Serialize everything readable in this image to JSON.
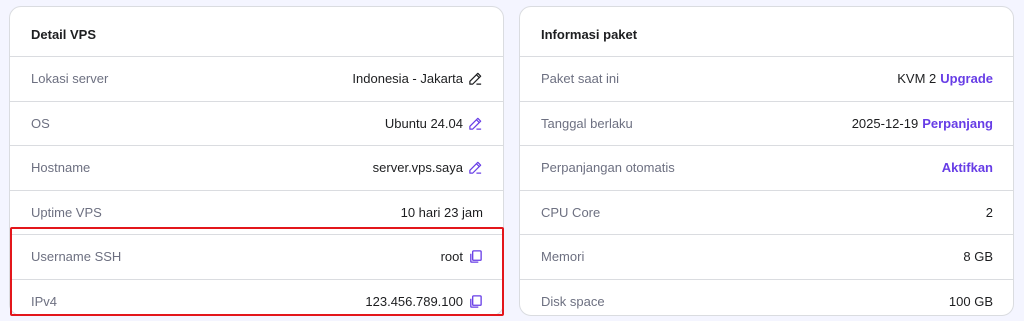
{
  "detail_vps": {
    "title": "Detail VPS",
    "rows": [
      {
        "label": "Lokasi server",
        "value": "Indonesia - Jakarta",
        "icon": "pencil-icon"
      },
      {
        "label": "OS",
        "value": "Ubuntu 24.04",
        "icon": "pencil-icon"
      },
      {
        "label": "Hostname",
        "value": "server.vps.saya",
        "icon": "pencil-icon"
      },
      {
        "label": "Uptime VPS",
        "value": "10 hari 23 jam"
      },
      {
        "label": "Username SSH",
        "value": "root",
        "icon": "copy-icon"
      },
      {
        "label": "IPv4",
        "value": "123.456.789.100",
        "icon": "copy-icon"
      }
    ]
  },
  "informasi_paket": {
    "title": "Informasi paket",
    "rows": [
      {
        "label": "Paket saat ini",
        "value": "KVM 2",
        "action": "Upgrade"
      },
      {
        "label": "Tanggal berlaku",
        "value": "2025-12-19",
        "action": "Perpanjang"
      },
      {
        "label": "Perpanjangan otomatis",
        "action": "Aktifkan"
      },
      {
        "label": "CPU Core",
        "value": "2"
      },
      {
        "label": "Memori",
        "value": "8 GB"
      },
      {
        "label": "Disk space",
        "value": "100 GB"
      }
    ]
  },
  "colors": {
    "accent": "#673de6",
    "highlight": "#e3161b",
    "label": "#6d7081",
    "text": "#1d1e20"
  }
}
